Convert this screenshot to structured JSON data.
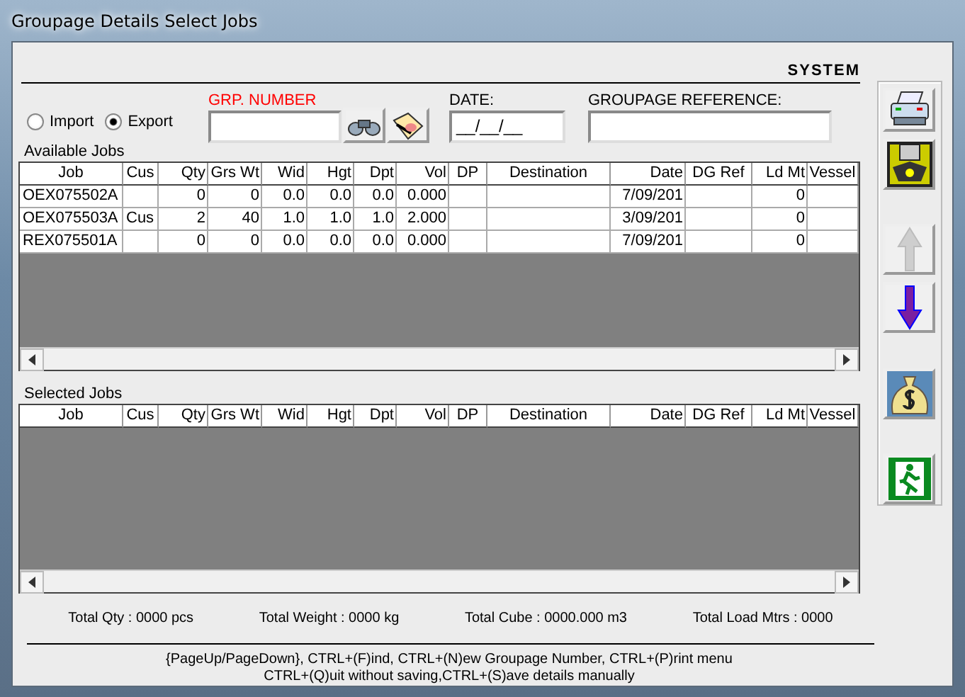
{
  "window": {
    "title": "Groupage Details Select Jobs"
  },
  "system_label": "SYSTEM",
  "mode": [
    {
      "label": "Import",
      "selected": false
    },
    {
      "label": "Export",
      "selected": true
    }
  ],
  "grp_number": {
    "label": "GRP. NUMBER"
  },
  "date": {
    "label": "DATE:",
    "value": "__/__/__"
  },
  "groupage_reference": {
    "label": "GROUPAGE REFERENCE:"
  },
  "available_jobs": {
    "title": "Available Jobs",
    "columns": [
      "Job",
      "Cus",
      "Qty",
      "Grs Wt",
      "Wid",
      "Hgt",
      "Dpt",
      "Vol",
      "DP",
      "Destination",
      "Date",
      "DG Ref",
      "Ld Mt",
      "Vessel"
    ],
    "rows": [
      [
        "OEX075502A",
        "",
        "0",
        "0",
        "0.0",
        "0.0",
        "0.0",
        "0.000",
        "",
        "",
        "7/09/201",
        "",
        "0",
        ""
      ],
      [
        "OEX075503A",
        "Cus",
        "2",
        "40",
        "1.0",
        "1.0",
        "1.0",
        "2.000",
        "",
        "",
        "3/09/201",
        "",
        "0",
        ""
      ],
      [
        "REX075501A",
        "",
        "0",
        "0",
        "0.0",
        "0.0",
        "0.0",
        "0.000",
        "",
        "",
        "7/09/201",
        "",
        "0",
        ""
      ]
    ]
  },
  "selected_jobs": {
    "title": "Selected Jobs",
    "columns": [
      "Job",
      "Cus",
      "Qty",
      "Grs Wt",
      "Wid",
      "Hgt",
      "Dpt",
      "Vol",
      "DP",
      "Destination",
      "Date",
      "DG Ref",
      "Ld Mt",
      "Vessel"
    ]
  },
  "totals": [
    "Total Qty : 0000 pcs",
    "Total Weight : 0000 kg",
    "Total Cube : 0000.000 m3",
    "Total Load Mtrs : 0000"
  ],
  "help": [
    "{PageUp/PageDown}, CTRL+(F)ind, CTRL+(N)ew Groupage Number, CTRL+(P)rint menu",
    "CTRL+(Q)uit without saving,CTRL+(S)ave details manually"
  ],
  "toolbar": [
    {
      "kind": "print",
      "disabled": false
    },
    {
      "kind": "save",
      "disabled": false
    },
    {
      "kind": "gap"
    },
    {
      "kind": "up",
      "disabled": true
    },
    {
      "kind": "down",
      "disabled": false
    },
    {
      "kind": "gap"
    },
    {
      "kind": "money",
      "disabled": false
    },
    {
      "kind": "gap"
    },
    {
      "kind": "exit",
      "disabled": false
    }
  ]
}
